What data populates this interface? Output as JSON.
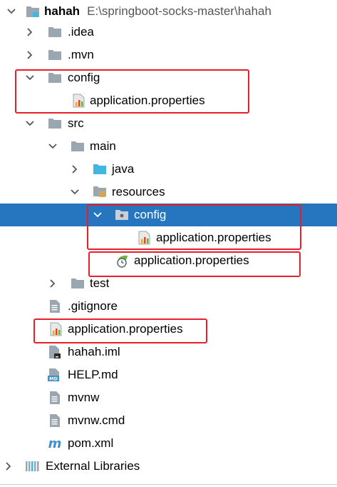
{
  "tree": {
    "root": {
      "name": "hahah",
      "path": "E:\\springboot-socks-master\\hahah"
    },
    "idea": ".idea",
    "mvn": ".mvn",
    "config": "config",
    "config_app_props": "application.properties",
    "src": "src",
    "main": "main",
    "java": "java",
    "resources": "resources",
    "res_config": "config",
    "res_config_app_props": "application.properties",
    "res_app_props": "application.properties",
    "test": "test",
    "gitignore": ".gitignore",
    "root_app_props": "application.properties",
    "iml": "hahah.iml",
    "help": "HELP.md",
    "mvnw": "mvnw",
    "mvnw_cmd": "mvnw.cmd",
    "pom": "pom.xml",
    "external_libraries": "External Libraries"
  },
  "colors": {
    "selection": "#2675bf",
    "highlight_box": "#e5202a",
    "folder": "#9aa7b0",
    "source_folder": "#40b6e0"
  }
}
